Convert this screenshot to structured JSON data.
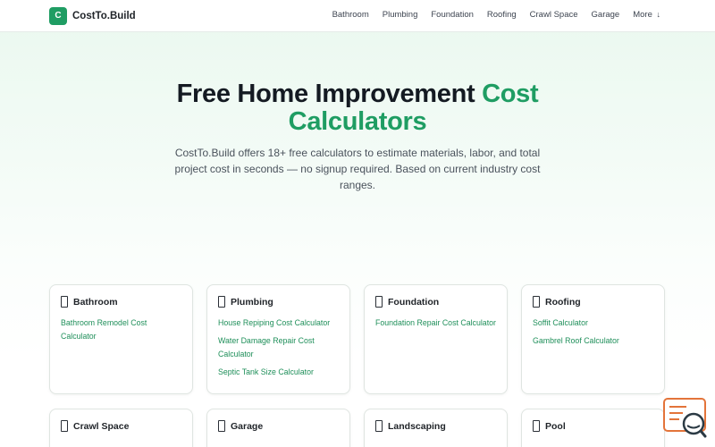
{
  "brand": {
    "logo_letter": "C",
    "name": "CostTo.Build"
  },
  "nav": {
    "items": [
      "Bathroom",
      "Plumbing",
      "Foundation",
      "Roofing",
      "Crawl Space",
      "Garage"
    ],
    "more_label": "More",
    "more_icon": "arrow-down-icon"
  },
  "hero": {
    "title_main": "Free Home Improvement",
    "title_accent_1": "Cost",
    "title_accent_2": "Calculators",
    "subtitle": "CostTo.Build offers 18+ free calculators to estimate materials, labor, and total project cost in seconds — no signup required. Based on current industry cost ranges."
  },
  "categories": [
    {
      "title": "Bathroom",
      "links": [
        "Bathroom Remodel Cost Calculator"
      ]
    },
    {
      "title": "Plumbing",
      "links": [
        "House Repiping Cost Calculator",
        "Water Damage Repair Cost Calculator",
        "Septic Tank Size Calculator"
      ]
    },
    {
      "title": "Foundation",
      "links": [
        "Foundation Repair Cost Calculator"
      ]
    },
    {
      "title": "Roofing",
      "links": [
        "Soffit Calculator",
        "Gambrel Roof Calculator"
      ]
    },
    {
      "title": "Crawl Space",
      "links": []
    },
    {
      "title": "Garage",
      "links": []
    },
    {
      "title": "Landscaping",
      "links": []
    },
    {
      "title": "Pool",
      "links": []
    }
  ],
  "colors": {
    "accent": "#1f9d63",
    "link": "#1f8f5a",
    "chat_widget": "#e3743a"
  }
}
